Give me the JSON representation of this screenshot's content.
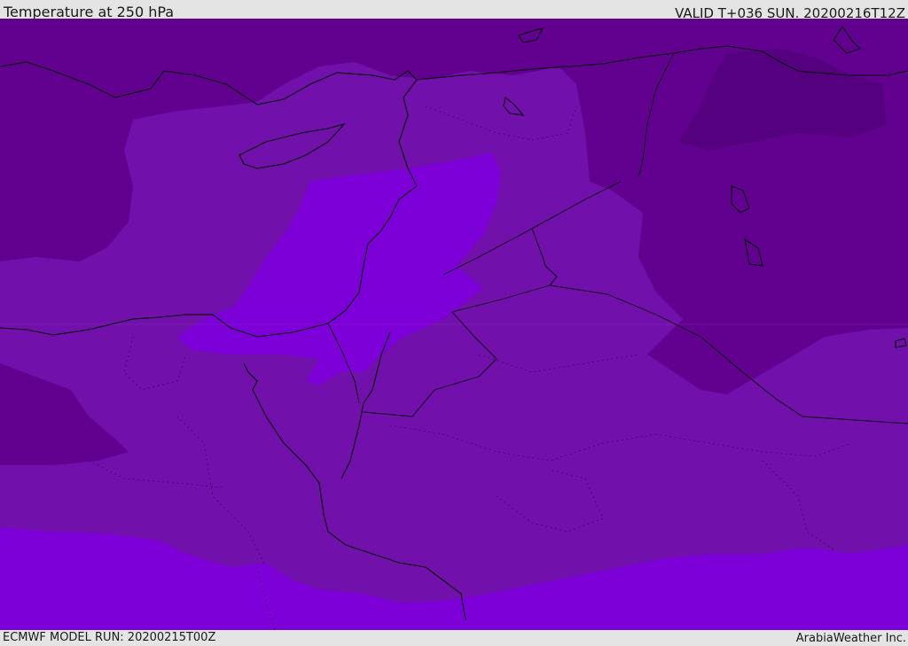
{
  "header": {
    "title": "Temperature at 250 hPa",
    "valid": "VALID T+036 SUN. 20200216T12Z"
  },
  "footer": {
    "model_run": "ECMWF MODEL RUN: 20200215T00Z",
    "brand": "ArabiaWeather Inc."
  },
  "map": {
    "colors": {
      "darkest": "#55007f",
      "dark": "#62008f",
      "medium": "#7210ac",
      "bright": "#7d00d8",
      "coast": "#000000",
      "border": "#000000"
    }
  }
}
